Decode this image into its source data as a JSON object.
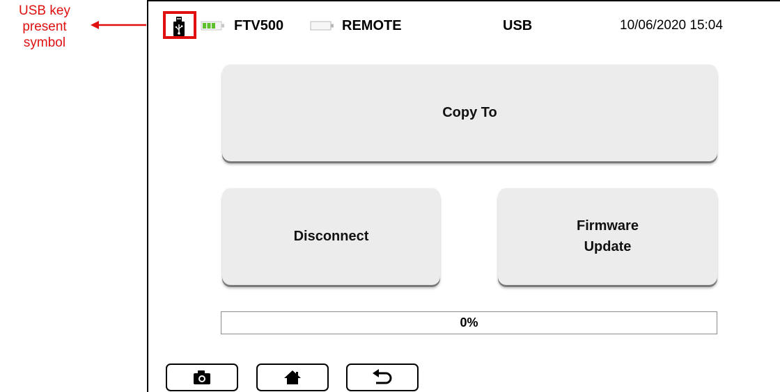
{
  "annotation": {
    "lines": [
      "USB key",
      "present",
      "symbol"
    ],
    "color": "#e01010"
  },
  "status_bar": {
    "usb_icon": "usb-key-icon",
    "battery_icon": "battery-icon",
    "device_name": "FTV500",
    "remote_battery_icon": "battery-empty-icon",
    "remote_label": "REMOTE",
    "mode": "USB",
    "datetime": "10/06/2020 15:04"
  },
  "buttons": {
    "copy_to": "Copy To",
    "disconnect": "Disconnect",
    "firmware_update": [
      "Firmware",
      "Update"
    ]
  },
  "progress": {
    "value": 0,
    "label": "0%"
  },
  "nav": [
    {
      "icon": "camera-icon"
    },
    {
      "icon": "home-icon"
    },
    {
      "icon": "back-icon"
    }
  ]
}
